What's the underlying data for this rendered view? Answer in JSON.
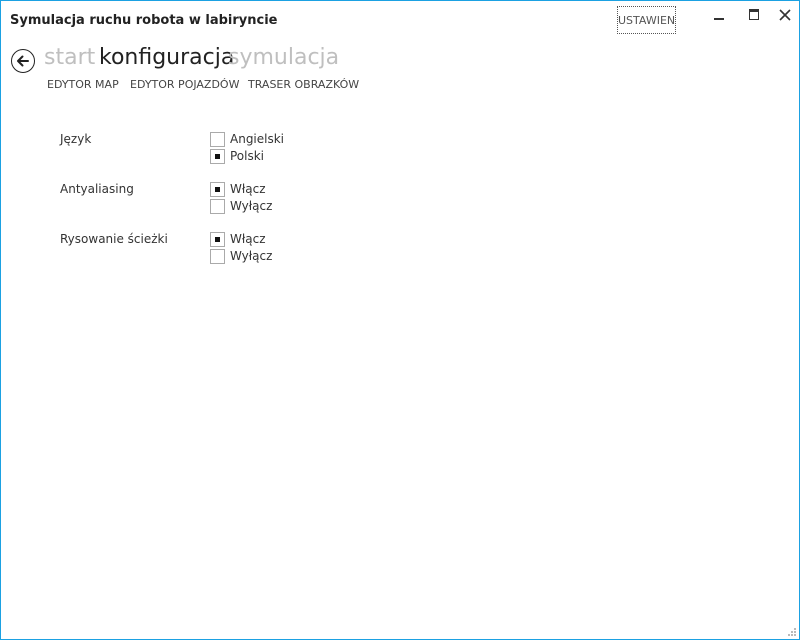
{
  "window": {
    "title": "Symulacja ruchu robota w labiryncie",
    "settings_label": "USTAWIENIA"
  },
  "nav": {
    "items": [
      {
        "label": "start",
        "active": false
      },
      {
        "label": "konfiguracja",
        "active": true
      },
      {
        "label": "symulacja",
        "active": false
      }
    ]
  },
  "subnav": {
    "items": [
      "EDYTOR MAP",
      "EDYTOR POJAZDÓW",
      "TRASER OBRAZKÓW"
    ]
  },
  "settings": [
    {
      "label": "Język",
      "options": [
        {
          "label": "Angielski",
          "checked": false
        },
        {
          "label": "Polski",
          "checked": true
        }
      ]
    },
    {
      "label": "Antyaliasing",
      "options": [
        {
          "label": "Włącz",
          "checked": true
        },
        {
          "label": "Wyłącz",
          "checked": false
        }
      ]
    },
    {
      "label": "Rysowanie ścieżki",
      "options": [
        {
          "label": "Włącz",
          "checked": true
        },
        {
          "label": "Wyłącz",
          "checked": false
        }
      ]
    }
  ],
  "colors": {
    "border": "#1ba1e2",
    "inactive_nav": "#bfbfbf",
    "active_nav": "#222222"
  }
}
